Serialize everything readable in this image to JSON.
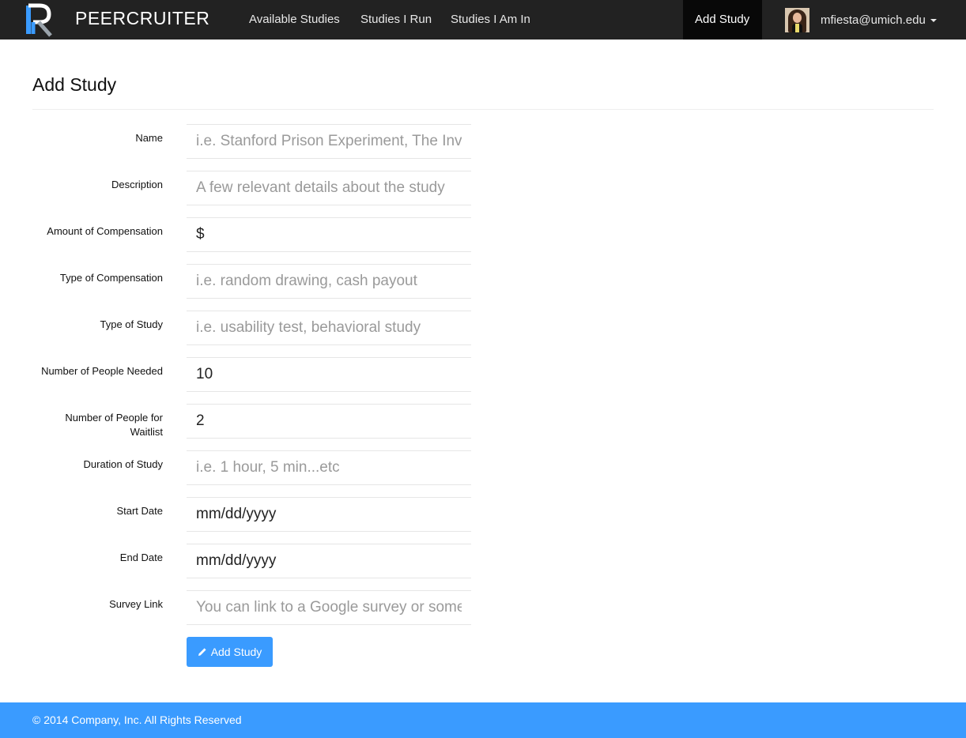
{
  "navbar": {
    "brand": "PEERCRUITER",
    "links": [
      {
        "label": "Available Studies"
      },
      {
        "label": "Studies I Run"
      },
      {
        "label": "Studies I Am In"
      }
    ],
    "active_link": "Add Study",
    "user_email": "mfiesta@umich.edu"
  },
  "page": {
    "title": "Add Study"
  },
  "form": {
    "fields": [
      {
        "label": "Name",
        "value": "",
        "placeholder": "i.e. Stanford Prison Experiment, The Inv"
      },
      {
        "label": "Description",
        "value": "",
        "placeholder": "A few relevant details about the study"
      },
      {
        "label": "Amount of Compensation",
        "value": "$",
        "placeholder": ""
      },
      {
        "label": "Type of Compensation",
        "value": "",
        "placeholder": "i.e. random drawing, cash payout"
      },
      {
        "label": "Type of Study",
        "value": "",
        "placeholder": "i.e. usability test, behavioral study"
      },
      {
        "label": "Number of People Needed",
        "value": "10",
        "placeholder": ""
      },
      {
        "label": "Number of People for Waitlist",
        "value": "2",
        "placeholder": ""
      },
      {
        "label": "Duration of Study",
        "value": "",
        "placeholder": "i.e. 1 hour, 5 min...etc"
      },
      {
        "label": "Start Date",
        "value": "mm/dd/yyyy",
        "placeholder": ""
      },
      {
        "label": "End Date",
        "value": "mm/dd/yyyy",
        "placeholder": ""
      },
      {
        "label": "Survey Link",
        "value": "",
        "placeholder": "You can link to a Google survey or some"
      }
    ],
    "submit_label": "Add Study"
  },
  "footer": {
    "text": "© 2014 Company, Inc. All Rights Reserved"
  },
  "colors": {
    "navbar_bg": "#222222",
    "accent": "#3a9bff",
    "logo_blue": "#3a9bff"
  }
}
